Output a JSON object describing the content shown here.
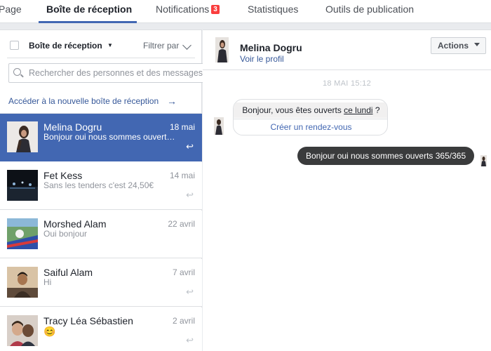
{
  "tabs": [
    {
      "label": "Page"
    },
    {
      "label": "Boîte de réception"
    },
    {
      "label": "Notifications",
      "badge": "3"
    },
    {
      "label": "Statistiques"
    },
    {
      "label": "Outils de publication"
    }
  ],
  "inbox": {
    "title": "Boîte de réception",
    "filter_label": "Filtrer par",
    "search_placeholder": "Rechercher des personnes et des messages",
    "new_inbox_link": "Accéder à la nouvelle boîte de réception",
    "conversations": [
      {
        "name": "Melina Dogru",
        "preview": "Bonjour oui nous sommes ouverts 365/365",
        "date": "18 mai",
        "selected": true
      },
      {
        "name": "Fet Kess",
        "preview": "Sans les tenders c'est 24,50€",
        "date": "14 mai"
      },
      {
        "name": "Morshed Alam",
        "preview": "Oui bonjour",
        "date": "22 avril"
      },
      {
        "name": "Saiful Alam",
        "preview": "Hi",
        "date": "7 avril"
      },
      {
        "name": "Tracy Léa Sébastien",
        "preview": "😊",
        "date": "2 avril"
      }
    ]
  },
  "conversation": {
    "name": "Melina Dogru",
    "profile_link": "Voir le profil",
    "actions_label": "Actions",
    "timestamp": "18 MAI 15:12",
    "incoming": {
      "text_before": "Bonjour, vous êtes ouverts ",
      "text_underlined": "ce lundi",
      "text_after": " ?",
      "cta": "Créer un rendez-vous"
    },
    "outgoing": {
      "text": "Bonjour oui nous sommes ouverts 365/365"
    }
  },
  "colors": {
    "accent": "#4267b2",
    "link": "#365899",
    "badge": "#fa3e3e",
    "outgoing_bubble": "#3a3b3c"
  }
}
